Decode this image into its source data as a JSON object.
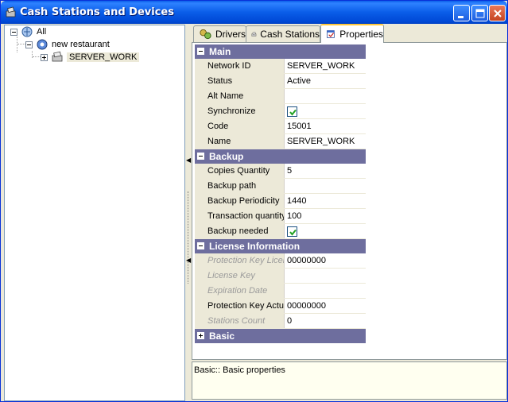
{
  "window": {
    "title": "Cash Stations and Devices",
    "controls": [
      "minimize",
      "maximize",
      "close"
    ]
  },
  "tree": {
    "nodes": [
      {
        "label": "All",
        "icon": "network-icon",
        "expanded": true
      },
      {
        "label": "new restaurant",
        "icon": "restaurant-icon",
        "expanded": true
      },
      {
        "label": "SERVER_WORK",
        "icon": "server-icon",
        "expanded": false,
        "selected": true
      }
    ]
  },
  "tabs": [
    {
      "label": "Drivers",
      "icon": "drivers-icon",
      "active": false
    },
    {
      "label": "Cash Stations",
      "icon": "cash-stations-icon",
      "active": false
    },
    {
      "label": "Properties",
      "icon": "properties-icon",
      "active": true
    }
  ],
  "properties": {
    "main": {
      "title": "Main",
      "rows": [
        {
          "name": "Network ID",
          "value": "SERVER_WORK"
        },
        {
          "name": "Status",
          "value": "Active"
        },
        {
          "name": "Alt Name",
          "value": ""
        },
        {
          "name": "Synchronize",
          "checked": true
        },
        {
          "name": "Code",
          "value": "15001"
        },
        {
          "name": "Name",
          "value": "SERVER_WORK"
        }
      ]
    },
    "backup": {
      "title": "Backup",
      "rows": [
        {
          "name": "Copies Quantity",
          "value": "5"
        },
        {
          "name": "Backup path",
          "value": ""
        },
        {
          "name": "Backup Periodicity",
          "value": "1440"
        },
        {
          "name": "Transaction quantity",
          "value": "100"
        },
        {
          "name": "Backup needed",
          "checked": true
        }
      ]
    },
    "license": {
      "title": "License Information",
      "rows": [
        {
          "name": "Protection Key License",
          "value": "00000000",
          "readonly": true
        },
        {
          "name": "License Key",
          "value": "",
          "readonly": true
        },
        {
          "name": "Expiration Date",
          "value": "",
          "readonly": true
        },
        {
          "name": "Protection Key Actual",
          "value": "00000000",
          "readonly": false
        },
        {
          "name": "Stations Count",
          "value": "0",
          "readonly": true
        }
      ]
    },
    "basic": {
      "title": "Basic",
      "collapsed": true
    }
  },
  "description": "Basic:: Basic properties",
  "colors": {
    "category_header": "#6E6E9E",
    "titlebar": "#0A5DE8",
    "active_tab_accent": "#FFC83C"
  }
}
